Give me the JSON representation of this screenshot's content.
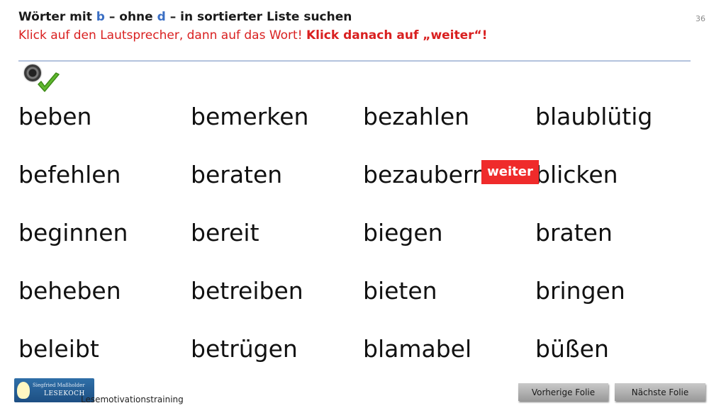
{
  "header": {
    "title_prefix": "Wörter mit ",
    "letter_b": "b",
    "title_mid": " – ohne ",
    "letter_d": "d",
    "title_suffix": " – in sortierter Liste suchen",
    "instruction_plain": "Klick auf den Lautsprecher, dann auf das Wort! ",
    "instruction_bold": "Klick danach auf „weiter“!",
    "slide_number": "36"
  },
  "words": {
    "col1": [
      "beben",
      "befehlen",
      "beginnen",
      "beheben",
      "beleibt"
    ],
    "col2": [
      "bemerken",
      "beraten",
      "bereit",
      "betreiben",
      "betrügen"
    ],
    "col3": [
      "bezahlen",
      "bezaubern",
      "biegen",
      "bieten",
      "blamabel"
    ],
    "col4": [
      "blaublütig",
      "blicken",
      "braten",
      "bringen",
      "büßen"
    ]
  },
  "weiter_label": "weiter",
  "footer": {
    "logo_line1": "Siegfried Maßholder",
    "logo_line2": "LESEKOCH",
    "label": "Lesemotivationstraining",
    "prev_label": "Vorherige  Folie",
    "next_label": "Nächste  Folie"
  },
  "icons": {
    "speaker": "speaker-icon",
    "check": "checkmark-icon"
  },
  "colors": {
    "accent_blue": "#3b6fc4",
    "instruction_red": "#d92020",
    "weiter_red": "#ef2b2b"
  }
}
